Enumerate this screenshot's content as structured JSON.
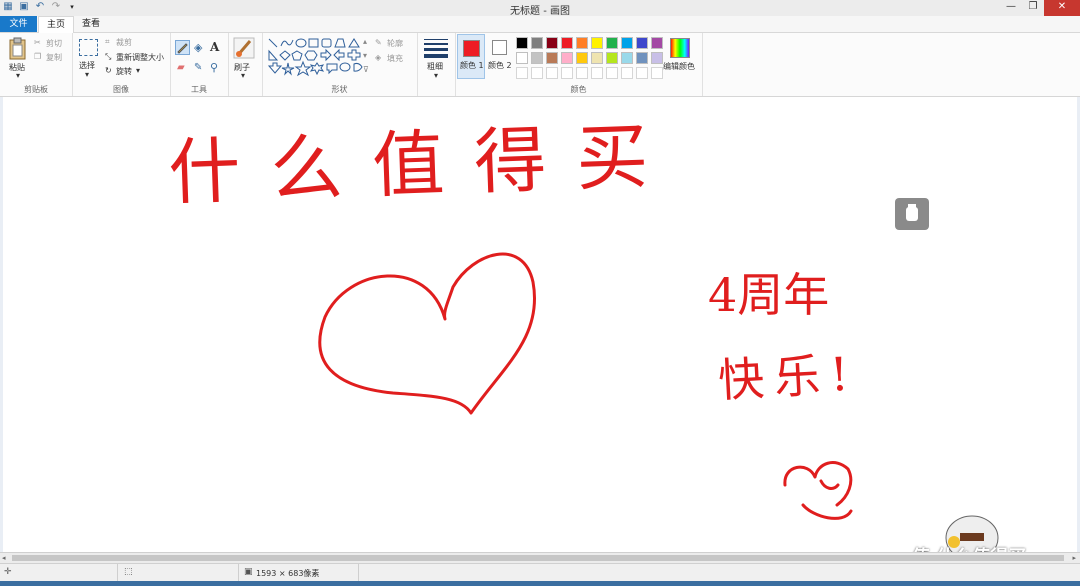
{
  "window": {
    "title": "无标题 - 画图"
  },
  "tabs": {
    "file": "文件",
    "home": "主页",
    "view": "查看"
  },
  "clipboard": {
    "paste": "粘贴",
    "cut": "剪切",
    "copy": "复制",
    "label": "剪贴板"
  },
  "image": {
    "select": "选择",
    "crop": "裁剪",
    "resize": "重新调整大小",
    "rotate": "旋转",
    "label": "图像"
  },
  "tools": {
    "label": "工具",
    "text_tool": "A"
  },
  "brushes": {
    "label": "刷子"
  },
  "shapes": {
    "outline": "轮廓",
    "fill": "填充",
    "label": "形状"
  },
  "size": {
    "label": "粗细"
  },
  "colors": {
    "color1_label": "颜色 1",
    "color2_label": "颜色 2",
    "edit_label": "编辑颜色",
    "group_label": "颜色",
    "color1": "#ed1c24",
    "color2": "#ffffff",
    "palette_row1": [
      "#000000",
      "#7f7f7f",
      "#880015",
      "#ed1c24",
      "#ff7f27",
      "#fff200",
      "#22b14c",
      "#00a2e8",
      "#3f48cc",
      "#a349a4"
    ],
    "palette_row2": [
      "#ffffff",
      "#c3c3c3",
      "#b97a57",
      "#ffaec9",
      "#ffc90e",
      "#efe4b0",
      "#b5e61d",
      "#99d9ea",
      "#7092be",
      "#c8bfe7"
    ]
  },
  "canvas": {
    "title_text": "什么值得买",
    "anniversary_text": "4周年",
    "happy_text": "快乐!",
    "ink_color": "#e01e1e"
  },
  "status": {
    "dimensions": "1593 × 683像素"
  },
  "watermark": {
    "text": "值 什么值得买"
  }
}
